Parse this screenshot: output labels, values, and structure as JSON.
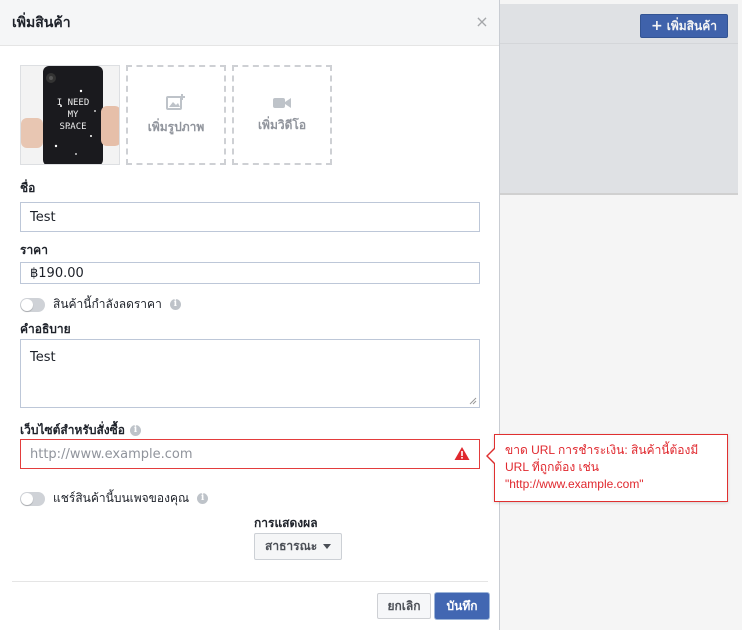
{
  "background": {
    "add_product_button": "เพิ่มสินค้า"
  },
  "dialog": {
    "title": "เพิ่มสินค้า",
    "close_glyph": "×",
    "media": {
      "add_photo_label": "เพิ่มรูปภาพ",
      "add_video_label": "เพิ่มวิดีโอ",
      "thumbnail_text": "I NEED MY SPACE"
    },
    "name": {
      "label": "ชื่อ",
      "value": "Test"
    },
    "price": {
      "label": "ราคา",
      "value": "฿190.00"
    },
    "on_sale": {
      "label": "สินค้านี้กำลังลดราคา",
      "enabled": false
    },
    "description": {
      "label": "คำอธิบาย",
      "value": "Test"
    },
    "website": {
      "label": "เว็บไซต์สำหรับสั่งซื้อ",
      "value": "",
      "placeholder": "http://www.example.com",
      "error": "ขาด URL การชำระเงิน: สินค้านี้ต้องมี URL ที่ถูกต้อง เช่น \"http://www.example.com\""
    },
    "share": {
      "label": "แชร์สินค้านี้บนเพจของคุณ",
      "enabled": false
    },
    "visibility": {
      "label": "การแสดงผล",
      "selected": "สาธารณะ"
    },
    "footer": {
      "cancel_label": "ยกเลิก",
      "save_label": "บันทึก"
    }
  },
  "colors": {
    "primary": "#4267b2",
    "error": "#e0282e",
    "header_bg": "#f5f6f7"
  }
}
